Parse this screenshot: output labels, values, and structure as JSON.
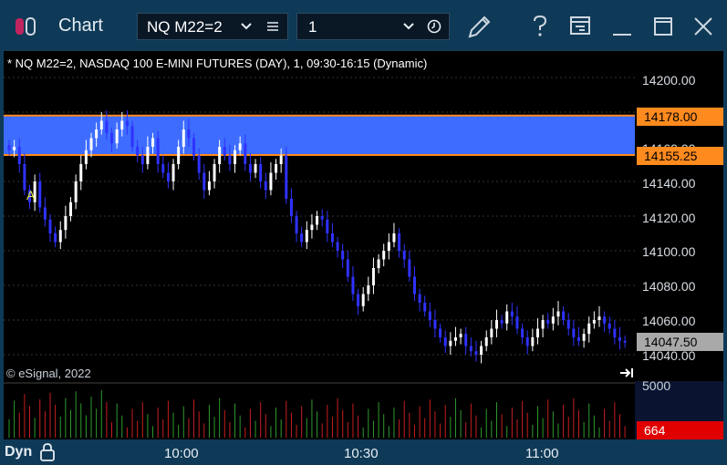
{
  "window": {
    "title": "Chart"
  },
  "toolbar": {
    "symbol": "NQ M22=2",
    "interval": "1",
    "icons": [
      "chevron-down-icon",
      "list-icon",
      "chevron-down-icon",
      "clock-icon",
      "pencil-icon",
      "help-icon",
      "export-icon",
      "minimize-icon",
      "maximize-icon",
      "close-icon"
    ]
  },
  "chart": {
    "study_title": "* NQ M22=2, NASDAQ 100 E-MINI FUTURES (DAY), 1, 09:30-16:15 (Dynamic)",
    "copyright": "© eSignal, 2022",
    "marker_label": "A",
    "band_color": "#3d6cff",
    "band_edge_color": "#ff8a1e",
    "up_color": "#ffffff",
    "down_color": "#2f32ff",
    "last_price": "14047.50",
    "price_ticks": [
      "14200.00",
      "14160.00",
      "14140.00",
      "14120.00",
      "14100.00",
      "14080.00",
      "14060.00",
      "14040.00"
    ],
    "band_top_label": "14178.00",
    "band_bottom_label": "14155.25",
    "volume_tick": "5000",
    "volume_value": "664",
    "time_labels": [
      "10:00",
      "10:30",
      "11:00"
    ],
    "dyn_label": "Dyn"
  },
  "chart_data": {
    "type": "candlestick",
    "title": "* NQ M22=2, NASDAQ 100 E-MINI FUTURES (DAY), 1, 09:30-16:15 (Dynamic)",
    "x": [
      "10:00",
      "10:30",
      "11:00"
    ],
    "ylim": [
      14030,
      14210
    ],
    "band": [
      14155.25,
      14178.0
    ],
    "last": 14047.5,
    "closes": [
      14158,
      14160,
      14150,
      14135,
      14128,
      14140,
      14125,
      14118,
      14110,
      14105,
      14112,
      14120,
      14128,
      14140,
      14150,
      14158,
      14165,
      14170,
      14175,
      14168,
      14162,
      14170,
      14175,
      14172,
      14160,
      14155,
      14150,
      14160,
      14165,
      14150,
      14145,
      14140,
      14150,
      14160,
      14170,
      14165,
      14155,
      14145,
      14135,
      14140,
      14150,
      14160,
      14155,
      14150,
      14158,
      14162,
      14150,
      14145,
      14150,
      14140,
      14135,
      14145,
      14150,
      14155,
      14130,
      14120,
      14110,
      14105,
      14112,
      14115,
      14120,
      14118,
      14110,
      14105,
      14100,
      14095,
      14085,
      14075,
      14068,
      14075,
      14080,
      14090,
      14095,
      14100,
      14105,
      14110,
      14100,
      14095,
      14085,
      14075,
      14070,
      14065,
      14060,
      14055,
      14050,
      14045,
      14048,
      14050,
      14052,
      14045,
      14042,
      14040,
      14045,
      14050,
      14055,
      14060,
      14058,
      14065,
      14062,
      14055,
      14050,
      14045,
      14050,
      14055,
      14060,
      14058,
      14062,
      14065,
      14060,
      14055,
      14050,
      14048,
      14052,
      14058,
      14060,
      14062,
      14058,
      14055,
      14050,
      14048,
      14047
    ],
    "volume_max": 5000,
    "volume_last": 664
  }
}
